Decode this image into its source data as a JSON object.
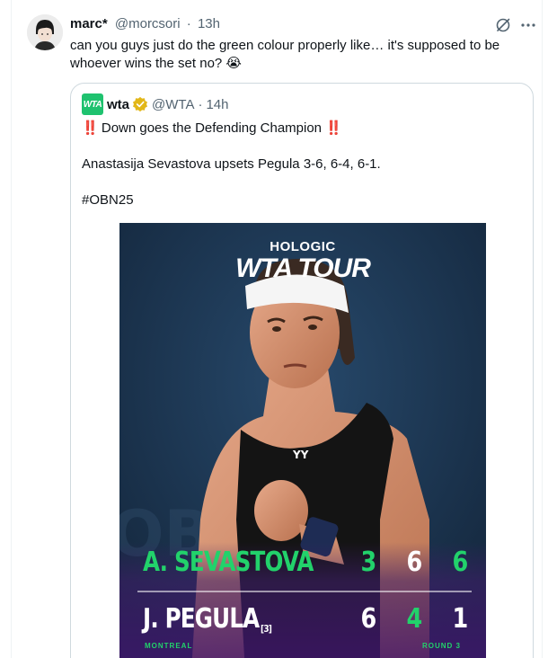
{
  "tweet": {
    "display_name": "marc*",
    "handle": "@morcsori",
    "separator": "·",
    "time": "13h",
    "text": "can you guys just do the green colour properly like… it's supposed to be whoever wins the set no? 😭",
    "icons": [
      "grok-icon",
      "more-icon"
    ]
  },
  "quote": {
    "logo_text": "WTA",
    "display_name": "wta",
    "handle": "@WTA",
    "separator": "·",
    "time": "14h",
    "line1_prefix": "‼️",
    "line1_text": " Down goes the Defending Champion ",
    "line1_suffix": "‼️",
    "line2": "Anastasija Sevastova upsets Pegula 3-6, 6-4, 6-1.",
    "line3": "#OBN25"
  },
  "graphic": {
    "brand_top": "HOLOGIC",
    "brand_main": "WTA TOUR",
    "player1": "A. SEVASTOVA",
    "player2": "J. PEGULA",
    "player2_seed": "[3]",
    "p1_sets": [
      "3",
      "6",
      "6"
    ],
    "p2_sets": [
      "6",
      "4",
      "1"
    ],
    "location": "MONTREAL",
    "round": "ROUND 3",
    "colors": {
      "winner_green": "#22d26b",
      "panel_purple": "#3b2458"
    }
  }
}
